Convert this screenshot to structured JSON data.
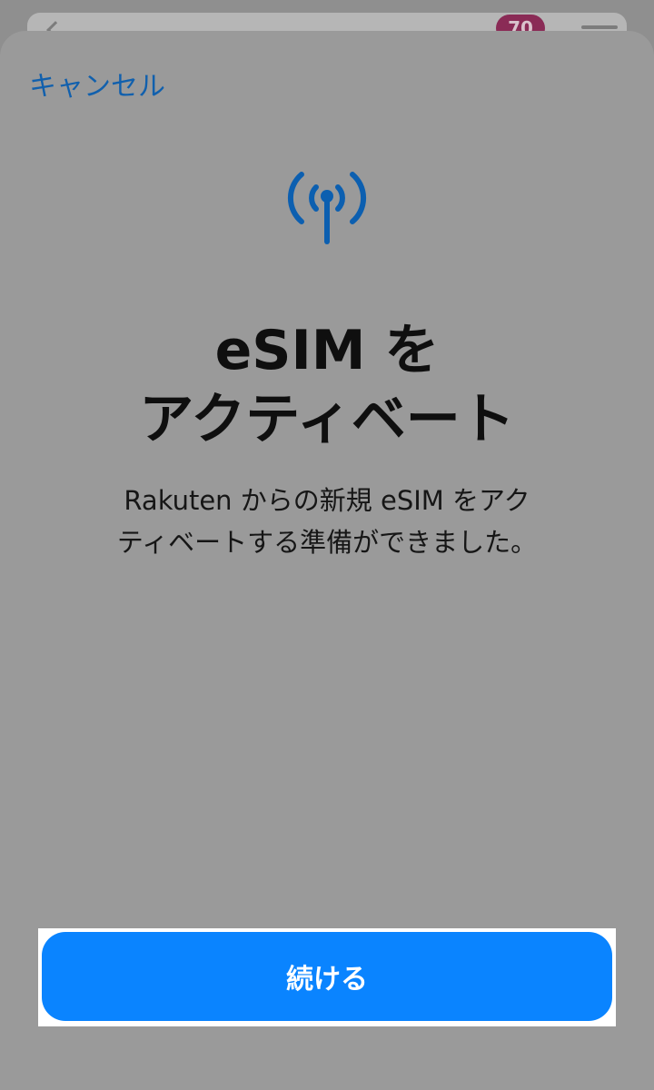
{
  "background_app": {
    "badge_count": "70"
  },
  "sheet": {
    "cancel_label": "キャンセル",
    "icon": "antenna-icon",
    "title_line1": "eSIM を",
    "title_line2": "アクティベート",
    "description_line1": "Rakuten からの新規 eSIM をアク",
    "description_line2": "ティベートする準備ができました。",
    "continue_label": "続ける"
  },
  "colors": {
    "accent": "#0a84ff",
    "link": "#1160ad",
    "icon": "#0c5fb0",
    "overlay": "#9a9a9a"
  }
}
